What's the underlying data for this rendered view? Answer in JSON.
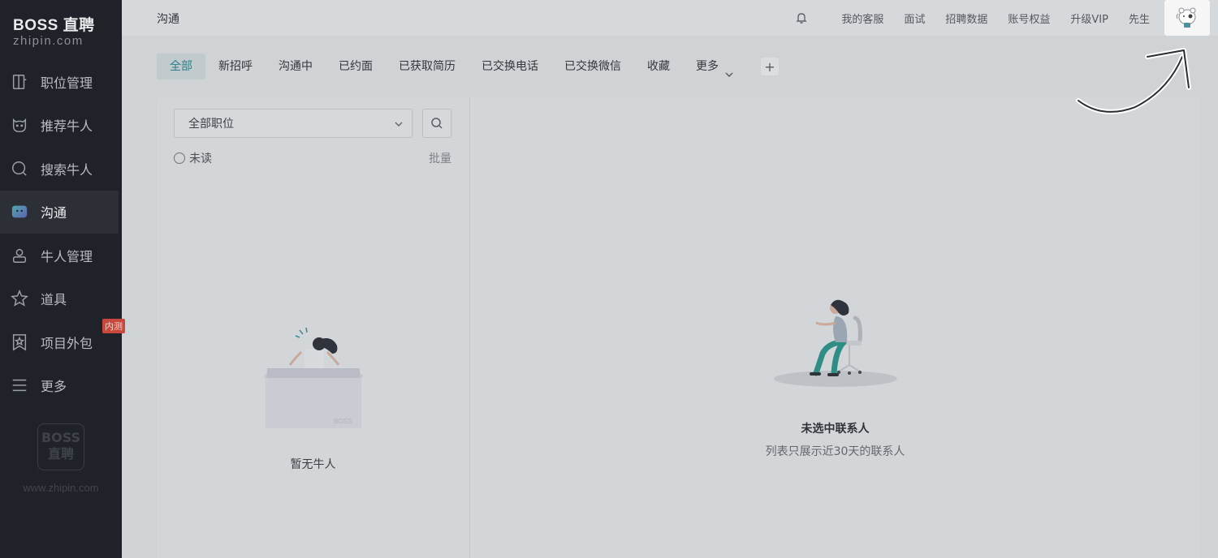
{
  "sidebar": {
    "logo_main": "BOSS 直聘",
    "logo_sub": "zhipin.com",
    "items": [
      {
        "label": "职位管理",
        "icon": "job-icon"
      },
      {
        "label": "推荐牛人",
        "icon": "cat-face-icon"
      },
      {
        "label": "搜索牛人",
        "icon": "search-icon"
      },
      {
        "label": "沟通",
        "icon": "chat-icon",
        "active": true
      },
      {
        "label": "牛人管理",
        "icon": "person-icon"
      },
      {
        "label": "道具",
        "icon": "star-icon"
      },
      {
        "label": "项目外包",
        "icon": "badge-star-icon",
        "badge": "内测"
      },
      {
        "label": "更多",
        "icon": "menu-icon"
      }
    ],
    "footer_logo_line1": "BOSS",
    "footer_logo_line2": "直聘",
    "footer_url": "www.zhipin.com"
  },
  "topbar": {
    "title": "沟通",
    "links": [
      "我的客服",
      "面试",
      "招聘数据",
      "账号权益",
      "升级VIP",
      "先生"
    ]
  },
  "tabs": {
    "items": [
      "全部",
      "新招呼",
      "沟通中",
      "已约面",
      "已获取简历",
      "已交换电话",
      "已交换微信",
      "收藏"
    ],
    "more_label": "更多",
    "add_label": "+"
  },
  "left_panel": {
    "select_value": "全部职位",
    "unread_label": "未读",
    "batch_label": "批量",
    "box_brand": "BOSS",
    "empty_text": "暂无牛人"
  },
  "right_panel": {
    "empty_title": "未选中联系人",
    "empty_subtitle": "列表只展示近30天的联系人"
  },
  "colors": {
    "accent": "#2c7f85",
    "sidebar_bg": "#1f2329",
    "badge": "#c8483b"
  }
}
